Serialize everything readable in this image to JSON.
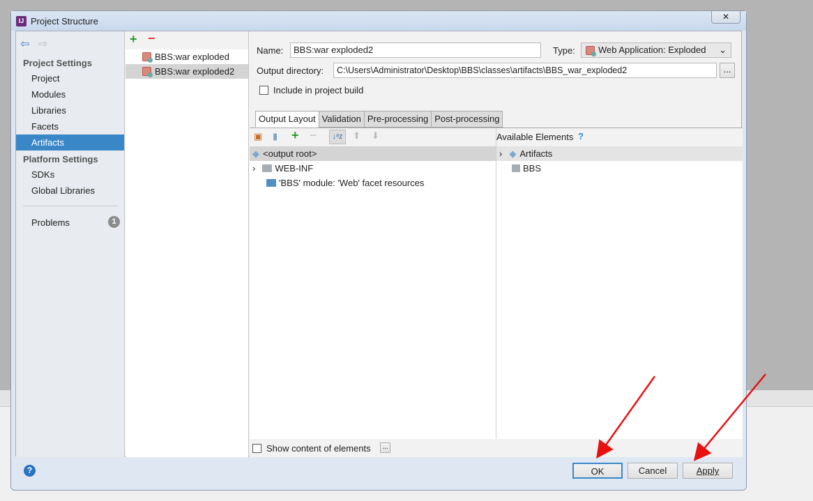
{
  "window": {
    "title": "Project Structure",
    "close": "✕"
  },
  "sidebar": {
    "project_settings": "Project Settings",
    "items": [
      "Project",
      "Modules",
      "Libraries",
      "Facets",
      "Artifacts"
    ],
    "platform_settings": "Platform Settings",
    "platform_items": [
      "SDKs",
      "Global Libraries"
    ],
    "problems": "Problems",
    "problems_count": "1",
    "selected": "Artifacts"
  },
  "artifacts": {
    "items": [
      "BBS:war exploded",
      "BBS:war exploded2"
    ],
    "selected": "BBS:war exploded2"
  },
  "form": {
    "name_label": "Name:",
    "name_value": "BBS:war exploded2",
    "type_label": "Type:",
    "type_value": "Web Application: Exploded",
    "output_label": "Output directory:",
    "output_value": "C:\\Users\\Administrator\\Desktop\\BBS\\classes\\artifacts\\BBS_war_exploded2",
    "browse": "...",
    "include_label": "Include in project build",
    "include_checked": false
  },
  "tabs": [
    "Output Layout",
    "Validation",
    "Pre-processing",
    "Post-processing"
  ],
  "layout": {
    "tree": [
      "<output root>",
      "WEB-INF",
      "'BBS' module: 'Web' facet resources"
    ],
    "available_title": "Available Elements",
    "available_help": "?",
    "available": [
      "Artifacts",
      "BBS"
    ],
    "show_content": "Show content of elements",
    "show_more": "..."
  },
  "footer": {
    "help": "?",
    "ok": "OK",
    "cancel": "Cancel",
    "apply": "Apply"
  },
  "colors": {
    "selection": "#3a87c8",
    "annotation_arrow": "#e81010"
  }
}
